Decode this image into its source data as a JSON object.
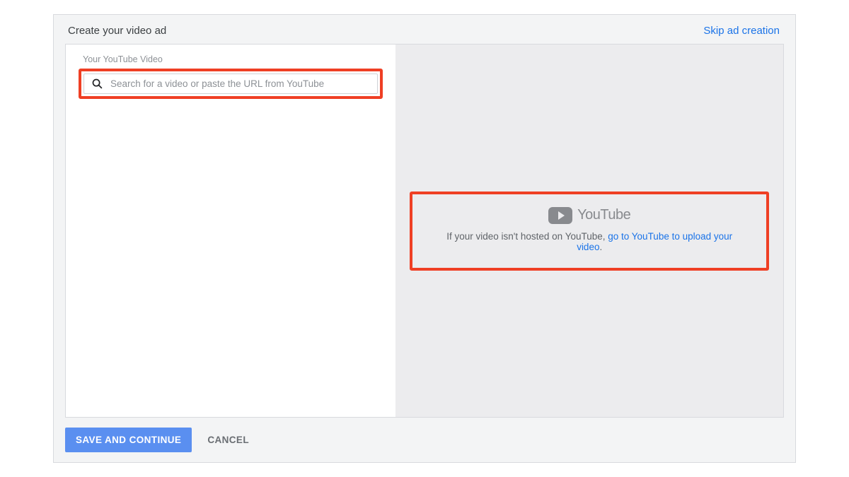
{
  "header": {
    "title": "Create your video ad",
    "skip": "Skip ad creation"
  },
  "left": {
    "field_label": "Your YouTube Video",
    "search_placeholder": "Search for a video or paste the URL from YouTube"
  },
  "right": {
    "logo_text": "YouTube",
    "hint_prefix": "If your video isn't hosted on YouTube, ",
    "hint_link": "go to YouTube to upload your video",
    "hint_suffix": "."
  },
  "footer": {
    "save": "SAVE AND CONTINUE",
    "cancel": "CANCEL"
  }
}
